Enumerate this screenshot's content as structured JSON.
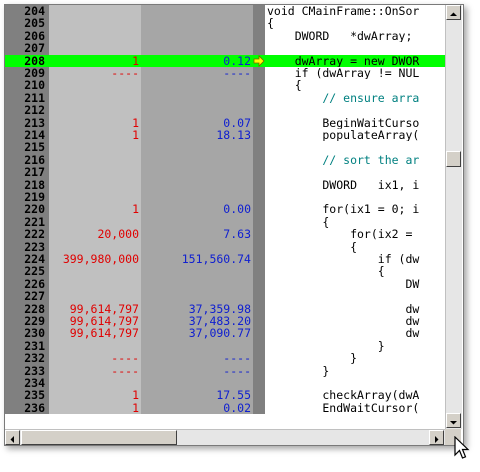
{
  "colors": {
    "highlight": "#00ff00",
    "count_text": "#e00000",
    "time_text": "#1020d0",
    "comment_text": "#008080"
  },
  "rows": [
    {
      "num": "204",
      "count": "",
      "time": "",
      "code": "void CMainFrame::OnSor"
    },
    {
      "num": "205",
      "count": "",
      "time": "",
      "code": "{"
    },
    {
      "num": "206",
      "count": "",
      "time": "",
      "code": "    DWORD   *dwArray;"
    },
    {
      "num": "207",
      "count": "",
      "time": "",
      "code": ""
    },
    {
      "num": "208",
      "count": "1",
      "time": "0.12",
      "code": "    dwArray = new DWOR",
      "hl": true
    },
    {
      "num": "209",
      "count": "----",
      "time": "----",
      "code": "    if (dwArray != NUL"
    },
    {
      "num": "210",
      "count": "",
      "time": "",
      "code": "    {"
    },
    {
      "num": "211",
      "count": "",
      "time": "",
      "code": "        // ensure arra",
      "comment": true
    },
    {
      "num": "212",
      "count": "",
      "time": "",
      "code": ""
    },
    {
      "num": "213",
      "count": "1",
      "time": "0.07",
      "code": "        BeginWaitCurso"
    },
    {
      "num": "214",
      "count": "1",
      "time": "18.13",
      "code": "        populateArray("
    },
    {
      "num": "215",
      "count": "",
      "time": "",
      "code": ""
    },
    {
      "num": "216",
      "count": "",
      "time": "",
      "code": "        // sort the ar",
      "comment": true
    },
    {
      "num": "217",
      "count": "",
      "time": "",
      "code": ""
    },
    {
      "num": "218",
      "count": "",
      "time": "",
      "code": "        DWORD   ix1, i"
    },
    {
      "num": "219",
      "count": "",
      "time": "",
      "code": ""
    },
    {
      "num": "220",
      "count": "1",
      "time": "0.00",
      "code": "        for(ix1 = 0; i"
    },
    {
      "num": "221",
      "count": "",
      "time": "",
      "code": "        {"
    },
    {
      "num": "222",
      "count": "20,000",
      "time": "7.63",
      "code": "            for(ix2 ="
    },
    {
      "num": "223",
      "count": "",
      "time": "",
      "code": "            {"
    },
    {
      "num": "224",
      "count": "399,980,000",
      "time": "151,560.74",
      "code": "                if (dw"
    },
    {
      "num": "225",
      "count": "",
      "time": "",
      "code": "                {"
    },
    {
      "num": "226",
      "count": "",
      "time": "",
      "code": "                    DW"
    },
    {
      "num": "227",
      "count": "",
      "time": "",
      "code": ""
    },
    {
      "num": "228",
      "count": "99,614,797",
      "time": "37,359.98",
      "code": "                    dw"
    },
    {
      "num": "229",
      "count": "99,614,797",
      "time": "37,483.20",
      "code": "                    dw"
    },
    {
      "num": "230",
      "count": "99,614,797",
      "time": "37,090.77",
      "code": "                    dw"
    },
    {
      "num": "231",
      "count": "",
      "time": "",
      "code": "                }"
    },
    {
      "num": "232",
      "count": "----",
      "time": "----",
      "code": "            }"
    },
    {
      "num": "233",
      "count": "----",
      "time": "----",
      "code": "        }"
    },
    {
      "num": "234",
      "count": "",
      "time": "",
      "code": ""
    },
    {
      "num": "235",
      "count": "1",
      "time": "17.55",
      "code": "        checkArray(dwA"
    },
    {
      "num": "236",
      "count": "1",
      "time": "0.02",
      "code": "        EndWaitCursor("
    }
  ]
}
